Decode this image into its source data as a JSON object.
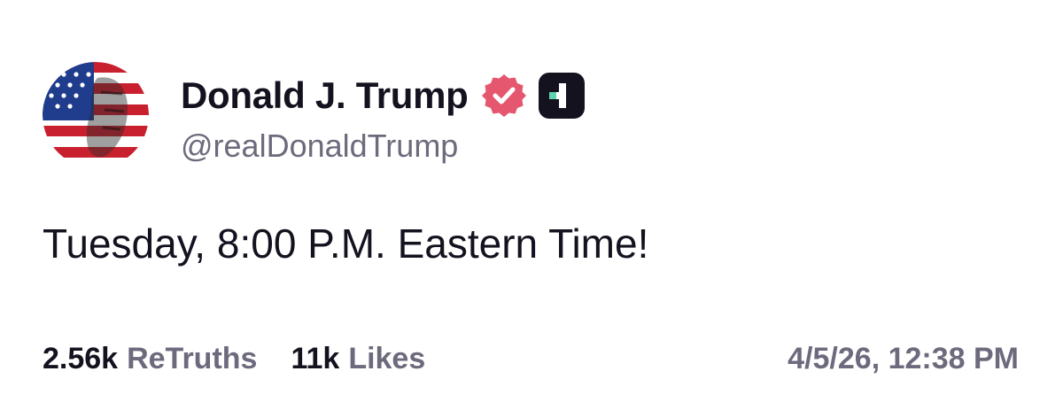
{
  "post": {
    "author": {
      "display_name": "Donald J. Trump",
      "handle": "@realDonaldTrump",
      "avatar": "flag-portrait-avatar",
      "verified_icon": "verified-badge-icon",
      "plus_icon": "plus-badge-icon"
    },
    "text": "Tuesday, 8:00 P.M. Eastern Time!",
    "stats": {
      "retruths_count": "2.56k",
      "retruths_label": "ReTruths",
      "likes_count": "11k",
      "likes_label": "Likes"
    },
    "timestamp": "4/5/26, 12:38 PM"
  },
  "colors": {
    "text_primary": "#14121f",
    "text_secondary": "#6c6a7c",
    "verified": "#e5576f",
    "plus_badge_bg": "#14121f",
    "plus_badge_accent": "#5ed3b0"
  }
}
